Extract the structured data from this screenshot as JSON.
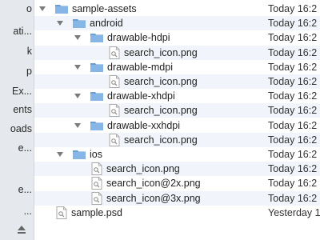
{
  "sidebar": {
    "items": [
      "o",
      "ati...",
      "k",
      "p",
      "Ex...",
      "ents",
      "oads",
      "e...",
      "",
      "e...",
      "..."
    ]
  },
  "files": [
    {
      "name": "sample-assets",
      "kind": "folder",
      "expanded": true,
      "depth": 0,
      "date": "Today 16:2"
    },
    {
      "name": "android",
      "kind": "folder",
      "expanded": true,
      "depth": 1,
      "date": "Today 16:2"
    },
    {
      "name": "drawable-hdpi",
      "kind": "folder",
      "expanded": true,
      "depth": 2,
      "date": "Today 16:2"
    },
    {
      "name": "search_icon.png",
      "kind": "image",
      "depth": 3,
      "date": "Today 16:2"
    },
    {
      "name": "drawable-mdpi",
      "kind": "folder",
      "expanded": true,
      "depth": 2,
      "date": "Today 16:2"
    },
    {
      "name": "search_icon.png",
      "kind": "image",
      "depth": 3,
      "date": "Today 16:2"
    },
    {
      "name": "drawable-xhdpi",
      "kind": "folder",
      "expanded": true,
      "depth": 2,
      "date": "Today 16:2"
    },
    {
      "name": "search_icon.png",
      "kind": "image",
      "depth": 3,
      "date": "Today 16:2"
    },
    {
      "name": "drawable-xxhdpi",
      "kind": "folder",
      "expanded": true,
      "depth": 2,
      "date": "Today 16:2"
    },
    {
      "name": "search_icon.png",
      "kind": "image",
      "depth": 3,
      "date": "Today 16:2"
    },
    {
      "name": "ios",
      "kind": "folder",
      "expanded": true,
      "depth": 1,
      "date": "Today 16:2"
    },
    {
      "name": "search_icon.png",
      "kind": "image",
      "depth": 2,
      "date": "Today 16:2"
    },
    {
      "name": "search_icon@2x.png",
      "kind": "image",
      "depth": 2,
      "date": "Today 16:2"
    },
    {
      "name": "search_icon@3x.png",
      "kind": "image",
      "depth": 2,
      "date": "Today 16:2"
    },
    {
      "name": "sample.psd",
      "kind": "image",
      "depth": 0,
      "date": "Yesterday 1"
    }
  ],
  "colors": {
    "folder": "#86b6e6",
    "folderDark": "#6a9fd3",
    "altRow": "#f1f5fb"
  }
}
